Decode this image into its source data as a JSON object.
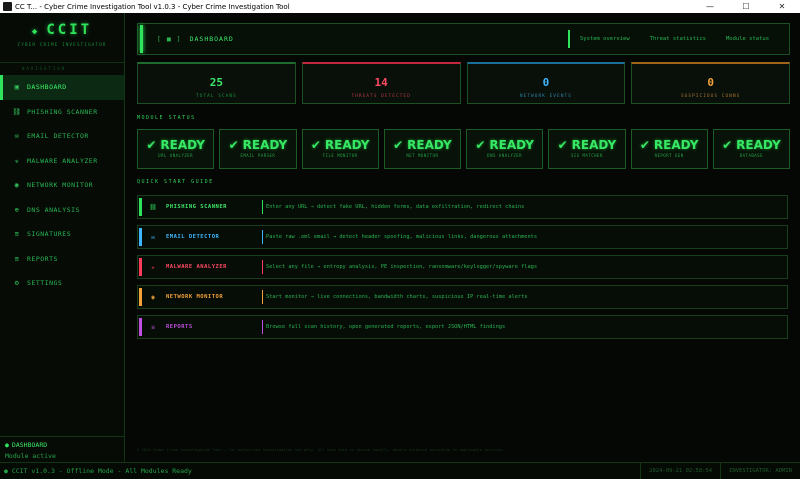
{
  "window": {
    "title": "CC T... - Cyber Crime Investigation Tool v1.0.3 - Cyber Crime Investigation Tool",
    "min": "—",
    "max": "☐",
    "close": "✕"
  },
  "brand": {
    "logo": "CCIT",
    "subtitle": "CYBER CRIME INVESTIGATOR"
  },
  "nav": {
    "heading": "NAVIGATION",
    "items": [
      {
        "icon": "▣",
        "label": "DASHBOARD"
      },
      {
        "icon": "⛓",
        "label": "PHISHING SCANNER"
      },
      {
        "icon": "✉",
        "label": "EMAIL DETECTOR"
      },
      {
        "icon": "☣",
        "label": "MALWARE ANALYZER"
      },
      {
        "icon": "◉",
        "label": "NETWORK MONITOR"
      },
      {
        "icon": "⊕",
        "label": "DNS ANALYSIS"
      },
      {
        "icon": "≡",
        "label": "SIGNATURES"
      },
      {
        "icon": "≡",
        "label": "REPORTS"
      },
      {
        "icon": "⚙",
        "label": "SETTINGS"
      }
    ]
  },
  "sidebar_footer": {
    "dot": "●",
    "current": "DASHBOARD",
    "status": "Module active"
  },
  "header": {
    "bracket": "[ ■ ]",
    "title": "DASHBOARD",
    "links": [
      "System overview",
      "Threat statistics",
      "Module status"
    ]
  },
  "stats": [
    {
      "value": "25",
      "label": "TOTAL SCANS",
      "color": "green"
    },
    {
      "value": "14",
      "label": "THREATS DETECTED",
      "color": "red"
    },
    {
      "value": "0",
      "label": "NETWORK EVENTS",
      "color": "blue"
    },
    {
      "value": "0",
      "label": "SUSPICIOUS CONNS",
      "color": "orange"
    }
  ],
  "module_status": {
    "title": "MODULE STATUS",
    "check": "✔",
    "ready_label": "READY",
    "modules": [
      "URL ANALYZER",
      "EMAIL PARSER",
      "FILE MONITOR",
      "NET MONITOR",
      "DNS ANALYZER",
      "SIG MATCHER",
      "REPORT GEN",
      "DATABASE"
    ]
  },
  "quick_start": {
    "title": "QUICK START GUIDE",
    "items": [
      {
        "icon": "⛓",
        "name": "PHISHING SCANNER",
        "desc": "Enter any URL → detect fake URL, hidden forms, data exfiltration, redirect chains",
        "color": "#2fe35c"
      },
      {
        "icon": "✉",
        "name": "EMAIL DETECTOR",
        "desc": "Paste raw .eml email → detect header spoofing, malicious links, dangerous attachments",
        "color": "#3fb6ff"
      },
      {
        "icon": "☣",
        "name": "MALWARE ANALYZER",
        "desc": "Select any file → entropy analysis, PE inspection, ransomware/keylogger/spyware flags",
        "color": "#ff3b5c"
      },
      {
        "icon": "◉",
        "name": "NETWORK MONITOR",
        "desc": "Start monitor → live connections, bandwidth charts, suspicious IP real-time alerts",
        "color": "#f3a23a"
      },
      {
        "icon": "≡",
        "name": "REPORTS",
        "desc": "Browse full scan history, open generated reports, export JSON/HTML findings",
        "color": "#c24fe0"
      }
    ]
  },
  "footer_note": "© 2024 Cyber Crime Investigation Tool — For authorized investigation use only. All scan data is stored locally. Handle evidence according to applicable policies.",
  "statusbar": {
    "left": "● CCIT v1.0.3  -  Offline Mode  -  All Modules Ready",
    "date": "2024-09-21  02:58:54",
    "user": "INVESTIGATOR: ADMIN"
  }
}
